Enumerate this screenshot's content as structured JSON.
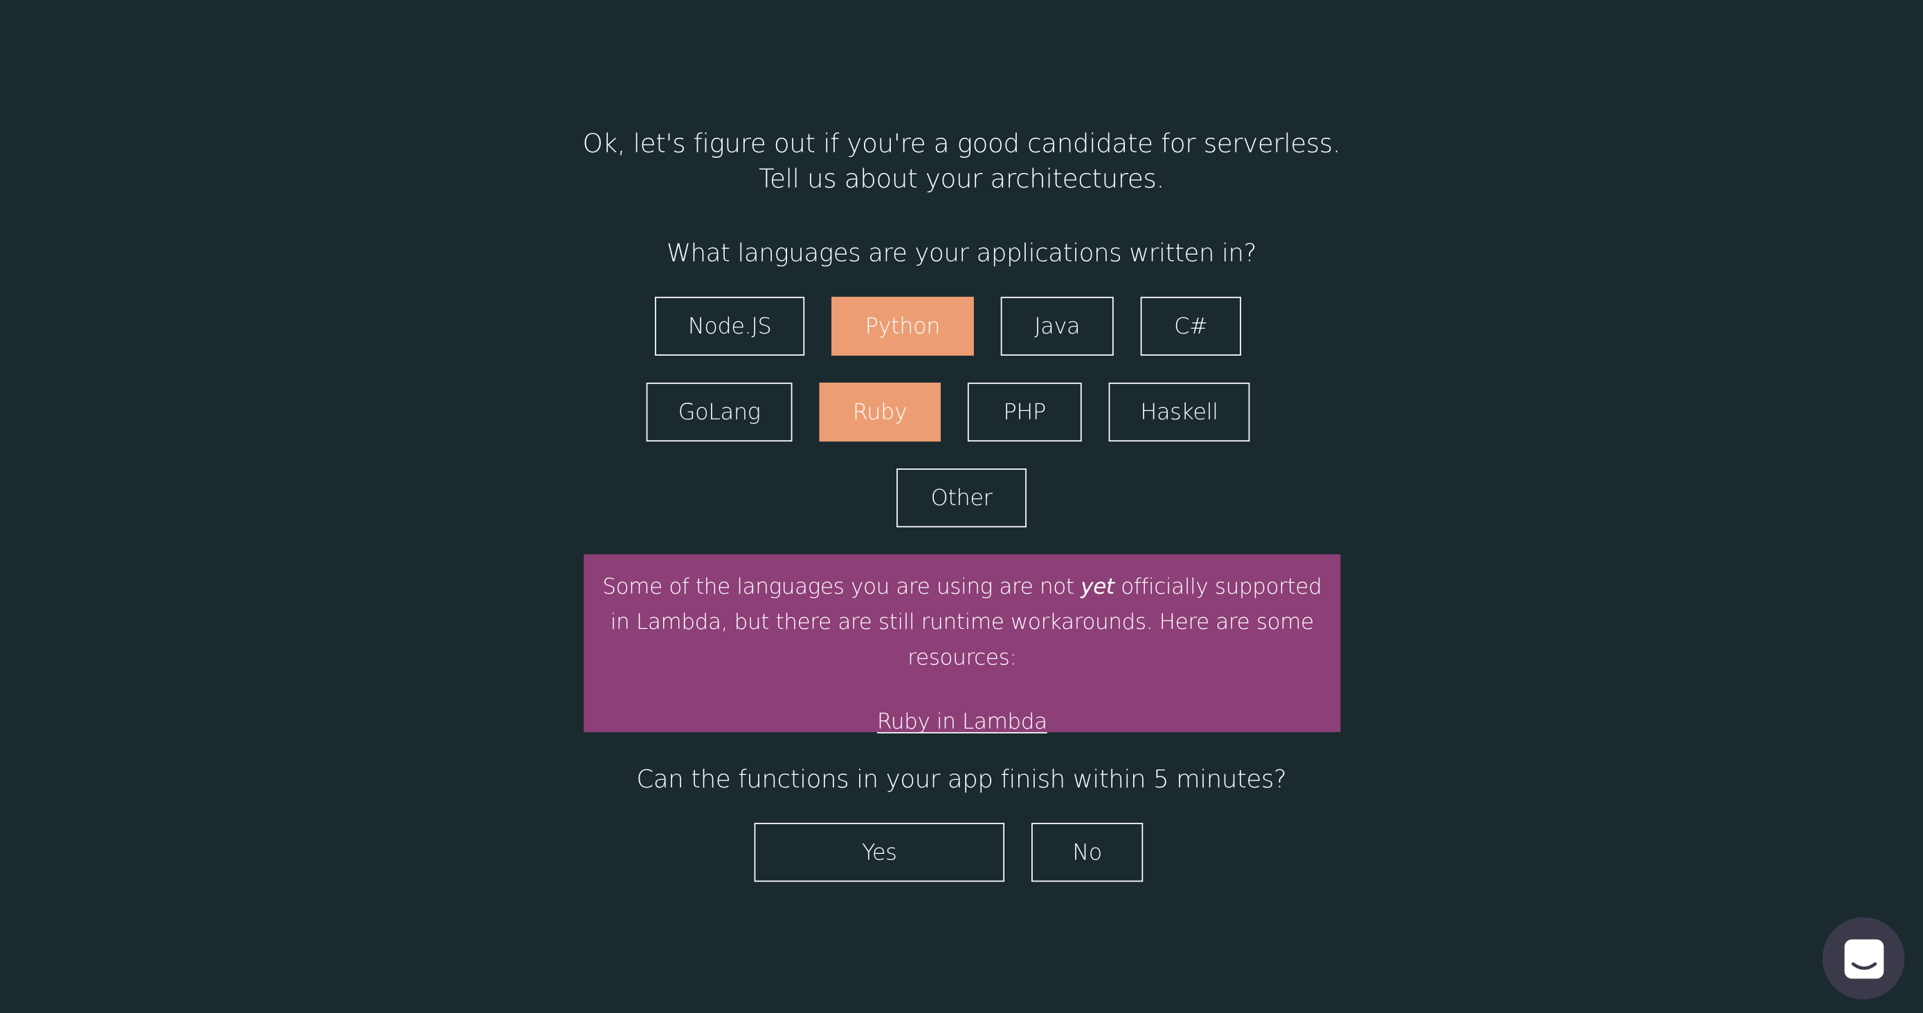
{
  "intro": {
    "line1": "Ok, let's figure out if you're a good candidate for serverless.",
    "line2": "Tell us about your architectures."
  },
  "languages": {
    "question": "What languages are your applications written in?",
    "options": [
      {
        "label": "Node.JS",
        "selected": false
      },
      {
        "label": "Python",
        "selected": true
      },
      {
        "label": "Java",
        "selected": false
      },
      {
        "label": "C#",
        "selected": false
      },
      {
        "label": "GoLang",
        "selected": false
      },
      {
        "label": "Ruby",
        "selected": true
      },
      {
        "label": "PHP",
        "selected": false
      },
      {
        "label": "Haskell",
        "selected": false
      },
      {
        "label": "Other",
        "selected": false
      }
    ]
  },
  "notice": {
    "text_before": "Some of the languages you are using are not ",
    "text_emphasis": "yet",
    "text_after": " officially supported in Lambda, but there are still runtime workarounds. Here are some resources:",
    "link_label": "Ruby in Lambda",
    "background": "#8d3f77"
  },
  "timeout": {
    "question": "Can the functions in your app finish within 5 minutes?",
    "yes_label": "Yes",
    "no_label": "No"
  },
  "chat": {
    "icon": "chat-bubble-icon"
  },
  "colors": {
    "background": "#1a2a2f",
    "selected": "#ec9d73",
    "text": "#ffffff"
  }
}
